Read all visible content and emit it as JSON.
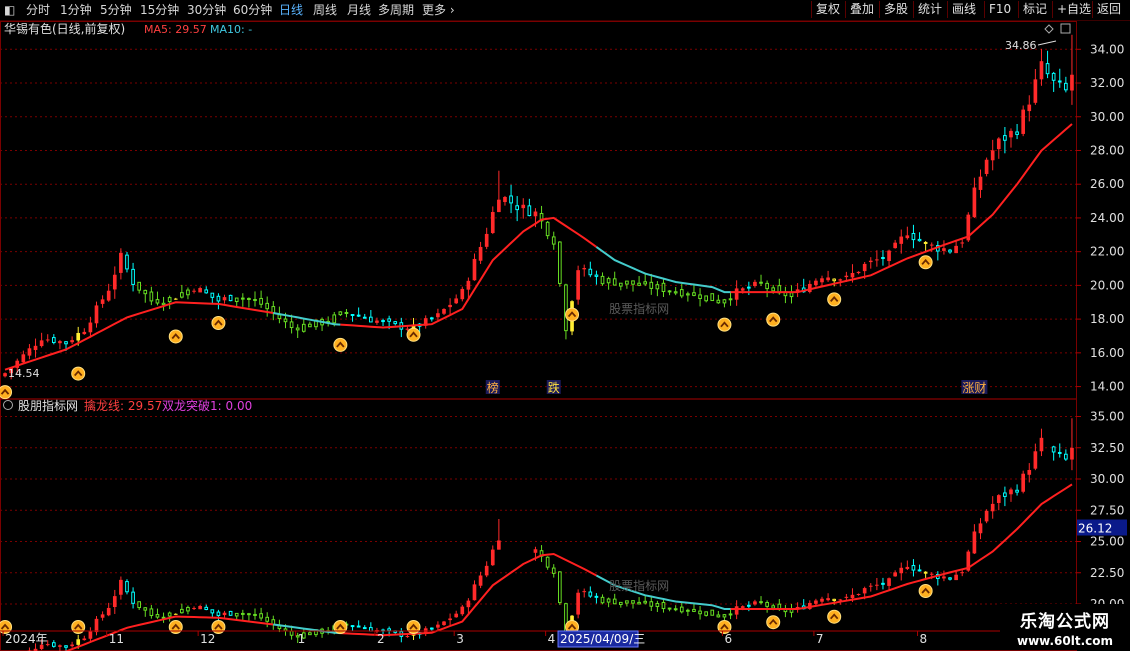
{
  "toolbar": {
    "left": [
      "分时",
      "1分钟",
      "5分钟",
      "15分钟",
      "30分钟",
      "60分钟",
      "日线",
      "周线",
      "月线",
      "多周期",
      "更多"
    ],
    "active": "日线",
    "right": [
      "复权",
      "叠加",
      "多股",
      "统计",
      "画线",
      "F10",
      "标记",
      "+自选",
      "返回"
    ]
  },
  "upper": {
    "stock_label": "华锡有色(日线,前复权)",
    "ma5_label": "MA5: 29.57",
    "ma10_label": "MA10: -",
    "high_label": "34.86",
    "low_label": "14.54",
    "yticks": [
      "34.00",
      "32.00",
      "30.00",
      "28.00",
      "26.00",
      "24.00",
      "22.00",
      "20.00",
      "18.00",
      "16.00",
      "14.00"
    ],
    "ylim": [
      13.5,
      35.5
    ],
    "events": [
      {
        "text": "榜",
        "index": 80
      },
      {
        "text": "跌",
        "index": 90
      },
      {
        "text": "涨财",
        "index": 159
      }
    ]
  },
  "lower": {
    "indicator_label": "股朋指标网",
    "line1_label": "擒龙线: 29.57",
    "line2_label": "双龙突破1: 0.00",
    "yticks": [
      "35.00",
      "32.50",
      "30.00",
      "27.50",
      "25.00",
      "22.50",
      "20.00"
    ],
    "ylim": [
      18.0,
      36.0
    ],
    "price_tag": "26.12"
  },
  "xaxis": {
    "labels": [
      {
        "text": "2024年",
        "index": 0
      },
      {
        "text": "11",
        "index": 17
      },
      {
        "text": "12",
        "index": 32
      },
      {
        "text": "1",
        "index": 48
      },
      {
        "text": "2",
        "index": 61
      },
      {
        "text": "3",
        "index": 74
      },
      {
        "text": "4",
        "index": 89
      },
      {
        "text": "6",
        "index": 118
      },
      {
        "text": "7",
        "index": 133
      },
      {
        "text": "8",
        "index": 150
      }
    ],
    "cursor_label": "2025/04/09/三",
    "cursor_index": 93
  },
  "ghost_text": "股票指标网",
  "watermark": {
    "line1": "乐淘公式网",
    "line2": "www.60lt.com"
  },
  "colors": {
    "up": "#ff2a2a",
    "down": "#00ffff",
    "green": "#66dd22",
    "yellow": "#ffee33",
    "ma": "#ff2020",
    "ma_cyan": "#44cccc",
    "grid": "#7a0000",
    "marker": "#ffb020"
  },
  "chart_data": {
    "type": "candlestick",
    "series": [
      {
        "name": "MA5",
        "values": []
      }
    ],
    "anchors": [
      [
        0,
        14.8
      ],
      [
        4,
        16.2
      ],
      [
        6,
        16.9
      ],
      [
        10,
        16.6
      ],
      [
        13,
        17.4
      ],
      [
        17,
        19.8
      ],
      [
        19,
        21.7
      ],
      [
        21,
        20.2
      ],
      [
        24,
        19.1
      ],
      [
        27,
        19.2
      ],
      [
        31,
        19.9
      ],
      [
        35,
        19.1
      ],
      [
        38,
        19.4
      ],
      [
        42,
        18.9
      ],
      [
        47,
        17.5
      ],
      [
        52,
        17.8
      ],
      [
        56,
        18.4
      ],
      [
        61,
        17.9
      ],
      [
        64,
        17.6
      ],
      [
        67,
        17.5
      ],
      [
        71,
        18.2
      ],
      [
        75,
        19.6
      ],
      [
        79,
        23.2
      ],
      [
        81,
        25.4
      ],
      [
        84,
        24.7
      ],
      [
        87,
        24.3
      ],
      [
        90,
        22.7
      ],
      [
        92,
        17.5
      ],
      [
        94,
        21.0
      ],
      [
        98,
        20.3
      ],
      [
        103,
        20.1
      ],
      [
        108,
        19.8
      ],
      [
        113,
        19.5
      ],
      [
        117,
        19.1
      ],
      [
        120,
        19.6
      ],
      [
        124,
        20.1
      ],
      [
        127,
        19.4
      ],
      [
        130,
        19.6
      ],
      [
        134,
        20.6
      ],
      [
        138,
        20.4
      ],
      [
        141,
        21.2
      ],
      [
        145,
        21.8
      ],
      [
        148,
        23.2
      ],
      [
        151,
        22.4
      ],
      [
        155,
        22.1
      ],
      [
        157,
        22.7
      ],
      [
        159,
        25.5
      ],
      [
        161,
        27.5
      ],
      [
        163,
        28.5
      ],
      [
        166,
        29.3
      ],
      [
        168,
        31.0
      ],
      [
        170,
        33.0
      ],
      [
        172,
        32.0
      ],
      [
        174,
        31.5
      ],
      [
        175,
        32.5
      ]
    ],
    "ma_anchors": [
      [
        0,
        15.0
      ],
      [
        10,
        16.2
      ],
      [
        20,
        18.1
      ],
      [
        28,
        19.0
      ],
      [
        35,
        18.9
      ],
      [
        45,
        18.3
      ],
      [
        54,
        17.7
      ],
      [
        62,
        17.5
      ],
      [
        70,
        17.7
      ],
      [
        75,
        18.6
      ],
      [
        80,
        21.5
      ],
      [
        85,
        23.2
      ],
      [
        88,
        23.9
      ],
      [
        90,
        24.0
      ],
      [
        95,
        22.8
      ],
      [
        100,
        21.5
      ],
      [
        105,
        20.7
      ],
      [
        110,
        20.2
      ],
      [
        116,
        19.9
      ],
      [
        118,
        19.6
      ],
      [
        124,
        19.6
      ],
      [
        130,
        19.6
      ],
      [
        136,
        20.1
      ],
      [
        142,
        20.6
      ],
      [
        148,
        21.6
      ],
      [
        154,
        22.4
      ],
      [
        158,
        22.9
      ],
      [
        162,
        24.2
      ],
      [
        166,
        26.0
      ],
      [
        170,
        28.0
      ],
      [
        175,
        29.57
      ]
    ],
    "cyan_ma_ranges": [
      [
        44,
        54
      ],
      [
        97,
        118
      ]
    ],
    "green_ranges": [
      [
        22,
        30
      ],
      [
        38,
        56
      ],
      [
        88,
        92
      ],
      [
        98,
        119
      ],
      [
        124,
        129
      ]
    ],
    "markers_upper": [
      [
        0,
        14.5
      ],
      [
        12,
        15.6
      ],
      [
        28,
        17.8
      ],
      [
        35,
        18.6
      ],
      [
        55,
        17.3
      ],
      [
        67,
        17.9
      ],
      [
        93,
        19.1
      ],
      [
        118,
        18.5
      ],
      [
        126,
        18.8
      ],
      [
        136,
        20.0
      ],
      [
        151,
        22.2
      ]
    ],
    "markers_lower": [
      0,
      12,
      28,
      35,
      55,
      67,
      93,
      118,
      126,
      136,
      151
    ],
    "count": 176,
    "xlabel": "",
    "ylabel": ""
  }
}
